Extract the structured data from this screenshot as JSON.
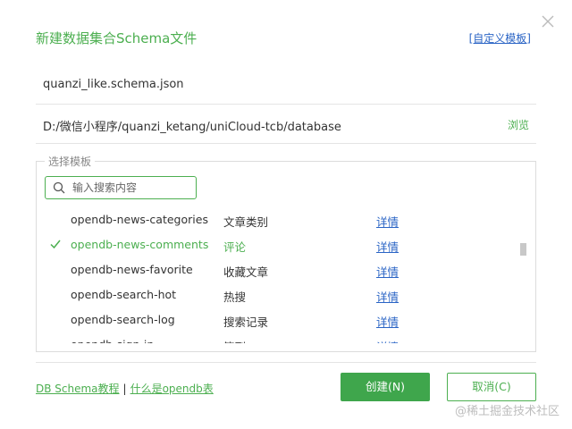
{
  "dialog": {
    "title": "新建数据集合Schema文件",
    "custom_template_link": "[自定义模板]"
  },
  "fields": {
    "filename": "quanzi_like.schema.json",
    "path": "D:/微信小程序/quanzi_ketang/uniCloud-tcb/database",
    "browse_label": "浏览"
  },
  "template": {
    "legend": "选择模板",
    "search_placeholder": "输入搜索内容",
    "rows": [
      {
        "name": "opendb-news-categories",
        "desc": "文章类别",
        "detail": "详情",
        "selected": false
      },
      {
        "name": "opendb-news-comments",
        "desc": "评论",
        "detail": "详情",
        "selected": true
      },
      {
        "name": "opendb-news-favorite",
        "desc": "收藏文章",
        "detail": "详情",
        "selected": false
      },
      {
        "name": "opendb-search-hot",
        "desc": "热搜",
        "detail": "详情",
        "selected": false
      },
      {
        "name": "opendb-search-log",
        "desc": "搜索记录",
        "detail": "详情",
        "selected": false
      },
      {
        "name": "opendb-sign-in",
        "desc": "签到",
        "detail": "详情",
        "selected": false
      }
    ]
  },
  "footer": {
    "tutorial_link": "DB Schema教程",
    "separator": "|",
    "opendb_link": "什么是opendb表",
    "create_label": "创建(N)",
    "cancel_label": "取消(C)"
  },
  "watermark": "@稀土掘金技术社区",
  "colors": {
    "accent": "#4caf50",
    "link": "#2a64c5",
    "button": "#3fa64c"
  }
}
